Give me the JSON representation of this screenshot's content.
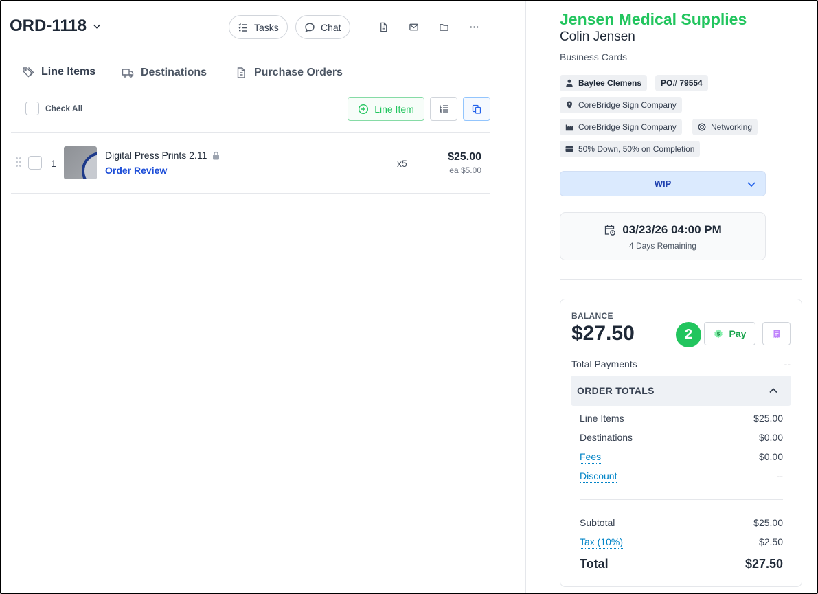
{
  "header": {
    "order_id": "ORD-1118",
    "tasks_label": "Tasks",
    "chat_label": "Chat",
    "icons": [
      "document-icon",
      "mail-icon",
      "folder-icon",
      "more-icon"
    ]
  },
  "tabs": [
    {
      "label": "Line Items",
      "icon": "tag-icon",
      "active": true
    },
    {
      "label": "Destinations",
      "icon": "truck-icon",
      "active": false
    },
    {
      "label": "Purchase Orders",
      "icon": "document-icon",
      "active": false
    }
  ],
  "toolbar": {
    "check_all_label": "Check All",
    "add_line_item_label": "Line Item"
  },
  "line_items": [
    {
      "number": "1",
      "name": "Digital Press Prints 2.11",
      "locked": true,
      "status": "Order Review",
      "quantity": "x5",
      "price": "$25.00",
      "each": "ea $5.00"
    }
  ],
  "customer": {
    "company": "Jensen Medical Supplies",
    "contact": "Colin Jensen",
    "product_type": "Business Cards",
    "salesperson": "Baylee Clemens",
    "po_number": "PO# 79554",
    "location": "CoreBridge Sign Company",
    "company_site": "CoreBridge Sign Company",
    "origin": "Networking",
    "payment_terms": "50% Down, 50% on Completion"
  },
  "status": {
    "value": "WIP"
  },
  "due": {
    "date": "03/23/26 04:00 PM",
    "remaining": "4 Days Remaining"
  },
  "balance": {
    "label": "BALANCE",
    "amount": "$27.50",
    "badge_count": "2",
    "pay_label": "Pay",
    "total_payments_label": "Total Payments",
    "total_payments_value": "--"
  },
  "order_totals": {
    "title": "ORDER TOTALS",
    "line_items_label": "Line Items",
    "line_items_value": "$25.00",
    "destinations_label": "Destinations",
    "destinations_value": "$0.00",
    "fees_label": "Fees",
    "fees_value": "$0.00",
    "discount_label": "Discount",
    "discount_value": "--",
    "subtotal_label": "Subtotal",
    "subtotal_value": "$25.00",
    "tax_label": "Tax (10%)",
    "tax_value": "$2.50",
    "total_label": "Total",
    "total_value": "$27.50"
  },
  "colors": {
    "brand_green": "#22c55e",
    "link_blue": "#1d4ed8",
    "status_bg": "#dbeafe"
  }
}
